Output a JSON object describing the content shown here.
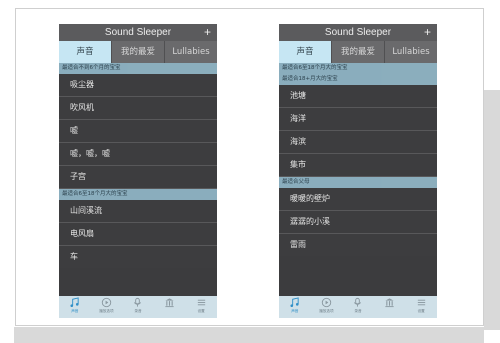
{
  "left": {
    "title": "Sound Sleeper",
    "plus": "+",
    "tabs": [
      "声音",
      "我的最爱",
      "Lullabies"
    ],
    "active_tab": 0,
    "sections": [
      {
        "header": "最适合不到6个月的宝宝",
        "items": [
          "吸尘器",
          "吹风机",
          "嘘",
          "嘘，嘘，嘘",
          "子宫"
        ]
      },
      {
        "header": "最适合6至18个月大的宝宝",
        "items": [
          "山间溪流",
          "电风扇",
          "车"
        ]
      }
    ],
    "bottom_tabs": [
      "声音",
      "播放选项",
      "录音",
      "",
      "设置"
    ],
    "active_bottom": 0
  },
  "right": {
    "title": "Sound Sleeper",
    "plus": "+",
    "tabs": [
      "声音",
      "我的最爱",
      "Lullabies"
    ],
    "active_tab": 0,
    "sections": [
      {
        "header": "最适合6至18个月大的宝宝",
        "items": []
      },
      {
        "header": "最适合18+月大的宝宝",
        "items": [
          "池塘",
          "海洋",
          "海滨",
          "集市"
        ]
      },
      {
        "header": "最适合父母",
        "items": [
          "暖暖的壁炉",
          "潺潺的小溪",
          "雷雨"
        ]
      }
    ],
    "bottom_tabs": [
      "声音",
      "播放选项",
      "录音",
      "",
      "设置"
    ],
    "active_bottom": 0
  },
  "colors": {
    "accent": "#2f8fc7",
    "active_tab_bg": "#c6e6f3",
    "section_header_bg": "#8fb4c4",
    "list_bg": "#3d3d3f"
  },
  "bottom_icons": [
    "music-icon",
    "play-options-icon",
    "record-icon",
    "library-icon",
    "menu-icon"
  ]
}
